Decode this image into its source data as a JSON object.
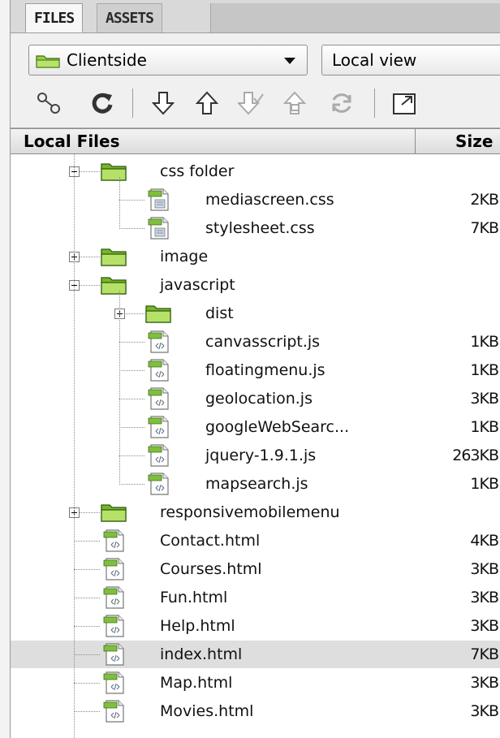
{
  "tabs": [
    {
      "label": "FILES",
      "active": true
    },
    {
      "label": "ASSETS",
      "active": false
    }
  ],
  "toolbar": {
    "site_select": "Clientside",
    "view_select": "Local view",
    "buttons": [
      "connect-icon",
      "refresh-icon",
      "get-files-icon",
      "put-files-icon",
      "check-out-icon",
      "check-in-icon",
      "synchronize-icon",
      "expand-icon"
    ]
  },
  "header": {
    "col_name": "Local Files",
    "col_size": "Size"
  },
  "tree": [
    {
      "name": "css folder",
      "size": "",
      "type": "folder",
      "level": 1,
      "expander": "minus"
    },
    {
      "name": "mediascreen.css",
      "size": "2KB",
      "type": "css",
      "level": 2
    },
    {
      "name": "stylesheet.css",
      "size": "7KB",
      "type": "css",
      "level": 2
    },
    {
      "name": "image",
      "size": "",
      "type": "folder",
      "level": 1,
      "expander": "plus"
    },
    {
      "name": "javascript",
      "size": "",
      "type": "folder",
      "level": 1,
      "expander": "minus"
    },
    {
      "name": "dist",
      "size": "",
      "type": "folder",
      "level": 2,
      "expander": "plus"
    },
    {
      "name": "canvasscript.js",
      "size": "1KB",
      "type": "code",
      "level": 2
    },
    {
      "name": "floatingmenu.js",
      "size": "1KB",
      "type": "code",
      "level": 2
    },
    {
      "name": "geolocation.js",
      "size": "3KB",
      "type": "code",
      "level": 2
    },
    {
      "name": "googleWebSearc...",
      "size": "1KB",
      "type": "code",
      "level": 2
    },
    {
      "name": "jquery-1.9.1.js",
      "size": "263KB",
      "type": "code",
      "level": 2
    },
    {
      "name": "mapsearch.js",
      "size": "1KB",
      "type": "code",
      "level": 2
    },
    {
      "name": "responsivemobilemenu",
      "size": "",
      "type": "folder",
      "level": 1,
      "expander": "plus"
    },
    {
      "name": "Contact.html",
      "size": "4KB",
      "type": "code",
      "level": 1
    },
    {
      "name": "Courses.html",
      "size": "3KB",
      "type": "code",
      "level": 1
    },
    {
      "name": "Fun.html",
      "size": "3KB",
      "type": "code",
      "level": 1
    },
    {
      "name": "Help.html",
      "size": "3KB",
      "type": "code",
      "level": 1
    },
    {
      "name": "index.html",
      "size": "7KB",
      "type": "code",
      "level": 1,
      "selected": true
    },
    {
      "name": "Map.html",
      "size": "3KB",
      "type": "code",
      "level": 1
    },
    {
      "name": "Movies.html",
      "size": "3KB",
      "type": "code",
      "level": 1
    }
  ],
  "colors": {
    "folder_green": "#8cc63f",
    "selected_row": "#dedede"
  }
}
